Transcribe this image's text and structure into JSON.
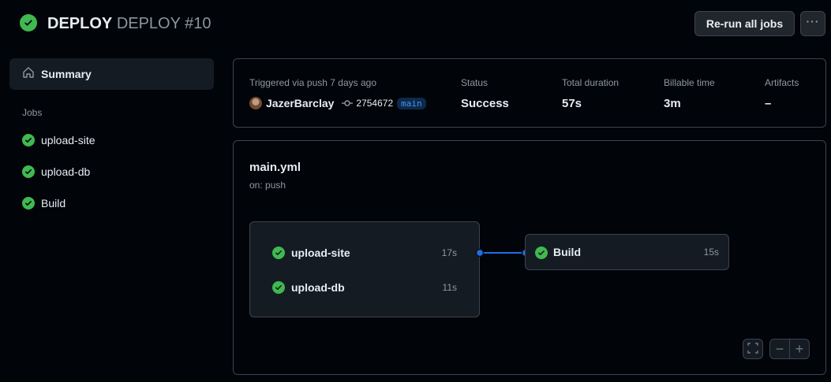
{
  "header": {
    "workflow_name": "DEPLOY",
    "run_title": "DEPLOY #10",
    "rerun_label": "Re-run all jobs",
    "more_label": "···"
  },
  "sidebar": {
    "summary_label": "Summary",
    "jobs_heading": "Jobs",
    "jobs": [
      {
        "label": "upload-site"
      },
      {
        "label": "upload-db"
      },
      {
        "label": "Build"
      }
    ]
  },
  "summary": {
    "trigger_label": "Triggered via push 7 days ago",
    "user": "JazerBarclay",
    "commit": "2754672",
    "branch": "main",
    "status_label": "Status",
    "status_value": "Success",
    "duration_label": "Total duration",
    "duration_value": "57s",
    "billable_label": "Billable time",
    "billable_value": "3m",
    "artifacts_label": "Artifacts",
    "artifacts_value": "–"
  },
  "graph": {
    "file": "main.yml",
    "trigger": "on: push",
    "group_jobs": [
      {
        "name": "upload-site",
        "duration": "17s"
      },
      {
        "name": "upload-db",
        "duration": "11s"
      }
    ],
    "build_job": {
      "name": "Build",
      "duration": "15s"
    },
    "zoom_out_label": "−",
    "zoom_in_label": "+"
  },
  "colors": {
    "success": "#3fb950",
    "accent": "#4493f8",
    "background": "#010409"
  }
}
